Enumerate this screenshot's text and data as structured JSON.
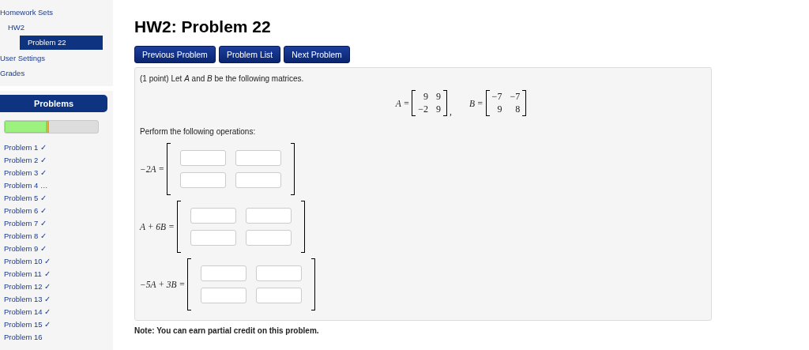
{
  "sidebar": {
    "nav": [
      {
        "label": "Homework Sets",
        "selected": false,
        "children": [
          {
            "label": "HW2",
            "selected": false,
            "children": [
              {
                "label": "Problem 22",
                "selected": true
              }
            ]
          }
        ]
      },
      {
        "label": "User Settings",
        "selected": false
      },
      {
        "label": "Grades",
        "selected": false
      }
    ],
    "problems_panel": {
      "title": "Problems",
      "progress": [
        {
          "kind": "correct",
          "level": 0.45
        },
        {
          "kind": "attempted",
          "level": 0.025
        }
      ],
      "items": [
        {
          "label": "Problem 1 ✓"
        },
        {
          "label": "Problem 2 ✓"
        },
        {
          "label": "Problem 3 ✓"
        },
        {
          "label": "Problem 4 …"
        },
        {
          "label": "Problem 5 ✓"
        },
        {
          "label": "Problem 6 ✓"
        },
        {
          "label": "Problem 7 ✓"
        },
        {
          "label": "Problem 8 ✓"
        },
        {
          "label": "Problem 9 ✓"
        },
        {
          "label": "Problem 10 ✓"
        },
        {
          "label": "Problem 11 ✓"
        },
        {
          "label": "Problem 12 ✓"
        },
        {
          "label": "Problem 13 ✓"
        },
        {
          "label": "Problem 14 ✓"
        },
        {
          "label": "Problem 15 ✓"
        },
        {
          "label": "Problem 16"
        }
      ]
    }
  },
  "main": {
    "title": "HW2: Problem 22",
    "buttons": [
      "Previous Problem",
      "Problem List",
      "Next Problem"
    ],
    "problem": {
      "intro": "(1 point) Let *A* and *B* be the following matrices.",
      "definitions": [
        {
          "label": "A =",
          "rows": [
            [
              "9",
              "9"
            ],
            [
              "−2",
              "9"
            ]
          ],
          "suffix": ","
        },
        {
          "label": "B =",
          "rows": [
            [
              "−7",
              "−7"
            ],
            [
              "9",
              "8"
            ]
          ]
        }
      ],
      "instruction": "Perform the following operations:",
      "answers": [
        {
          "label": "−2A =",
          "fields": [
            [
              {
                "kind": "input"
              },
              {
                "kind": "input"
              }
            ],
            [
              {
                "kind": "input"
              },
              {
                "kind": "input"
              }
            ]
          ]
        },
        {
          "label": "A + 6B =",
          "fields": [
            [
              {
                "kind": "input"
              },
              {
                "kind": "input"
              }
            ],
            [
              {
                "kind": "input"
              },
              {
                "kind": "input"
              }
            ]
          ]
        },
        {
          "label": "−5A + 3B =",
          "fields": [
            [
              {
                "kind": "input"
              },
              {
                "kind": "input"
              }
            ],
            [
              {
                "kind": "input"
              },
              {
                "kind": "input"
              }
            ]
          ]
        }
      ]
    },
    "note": "Note: You can earn partial credit on this problem."
  }
}
